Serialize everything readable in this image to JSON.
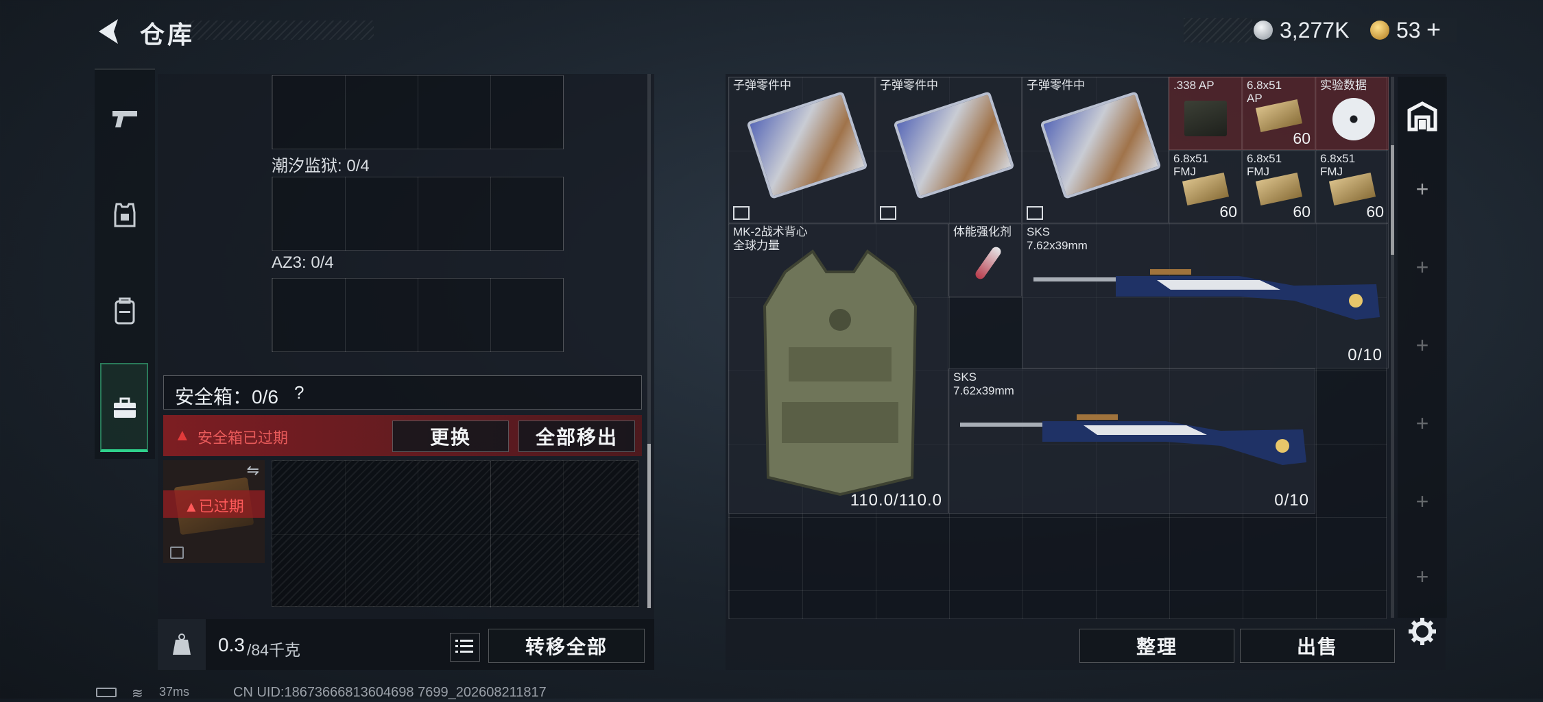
{
  "header": {
    "title": "仓库",
    "currency1": "3,277K",
    "currency2": "53",
    "currency2_plus": "+"
  },
  "storage_sections": [
    {
      "label": "潮汐监狱: 0/4"
    },
    {
      "label": "AZ3: 0/4"
    }
  ],
  "safebox": {
    "title": "安全箱：0/6",
    "help": "?",
    "expired_warning": "安全箱已过期",
    "replace_button": "更换",
    "move_all_out_button": "全部移出",
    "expired_badge": "已过期"
  },
  "weight": {
    "current": "0.3",
    "capacity": "/84千克",
    "transfer_all_button": "转移全部"
  },
  "inventory": {
    "items": [
      {
        "label": "子弹零件中"
      },
      {
        "label": "子弹零件中"
      },
      {
        "label": "子弹零件中"
      },
      {
        "label": ".338 AP",
        "qty": ""
      },
      {
        "label": "6.8x51 AP",
        "qty": "60"
      },
      {
        "label": "实验数据"
      },
      {
        "label": "6.8x51 FMJ",
        "qty": "60"
      },
      {
        "label": "6.8x51 FMJ",
        "qty": "60"
      },
      {
        "label": "6.8x51 FMJ",
        "qty": "60"
      },
      {
        "label": "MK-2战术背心",
        "sub": "全球力量",
        "durability": "110.0/110.0"
      },
      {
        "label": "体能强化剂"
      },
      {
        "label": "SKS",
        "sub": "7.62x39mm",
        "ammo": "0/10"
      },
      {
        "label": "SKS",
        "sub": "7.62x39mm",
        "ammo": "0/10"
      }
    ],
    "sort_button": "整理",
    "sell_button": "出售"
  },
  "status": {
    "ping": "37ms",
    "uid": "CN UID:18673666813604698 7699_202608211817"
  },
  "colors": {
    "accent_green": "#2fd28c",
    "warning_red": "#e23a3a",
    "item_red": "#7a3034",
    "coin_gold": "#d8a640"
  }
}
